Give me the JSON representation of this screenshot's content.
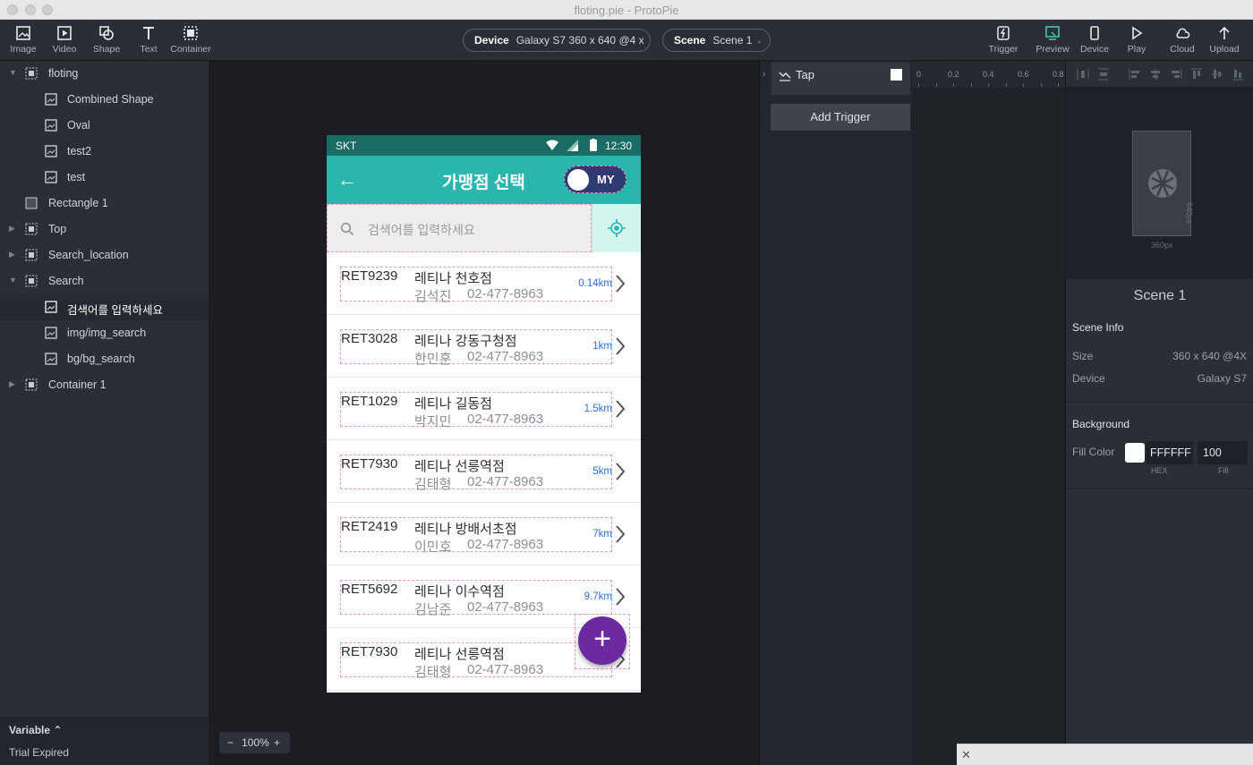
{
  "window": {
    "title": "floting.pie - ProtoPie"
  },
  "toolbar": {
    "left_tools": [
      {
        "label": "Image",
        "icon": "image-icon"
      },
      {
        "label": "Video",
        "icon": "video-icon"
      },
      {
        "label": "Shape",
        "icon": "shape-icon"
      },
      {
        "label": "Text",
        "icon": "text-icon"
      },
      {
        "label": "Container",
        "icon": "container-icon"
      }
    ],
    "device_label": "Device",
    "device_value": "Galaxy S7  360 x 640  @4 x",
    "scene_label": "Scene",
    "scene_value": "Scene 1",
    "right_tools": [
      {
        "label": "Trigger",
        "icon": "trigger-icon"
      },
      {
        "label": "Preview",
        "icon": "preview-icon"
      },
      {
        "label": "Device",
        "icon": "device-icon"
      },
      {
        "label": "Play",
        "icon": "play-icon"
      },
      {
        "label": "Cloud",
        "icon": "cloud-icon"
      },
      {
        "label": "Upload",
        "icon": "upload-icon"
      }
    ]
  },
  "layers": [
    {
      "name": "floting",
      "type": "container",
      "expanded": true,
      "indent": 0
    },
    {
      "name": "Combined Shape",
      "type": "image",
      "indent": 1
    },
    {
      "name": "Oval",
      "type": "image",
      "indent": 1
    },
    {
      "name": "test2",
      "type": "image",
      "indent": 1
    },
    {
      "name": "test",
      "type": "image",
      "indent": 1
    },
    {
      "name": "Rectangle 1",
      "type": "rect",
      "indent": 0
    },
    {
      "name": "Top",
      "type": "container",
      "expanded": false,
      "indent": 0
    },
    {
      "name": "Search_location",
      "type": "container",
      "expanded": false,
      "indent": 0
    },
    {
      "name": "Search",
      "type": "container",
      "expanded": true,
      "indent": 0
    },
    {
      "name": "검색어를 입력하세요",
      "type": "image",
      "indent": 1,
      "selected": true
    },
    {
      "name": "img/img_search",
      "type": "image",
      "indent": 1
    },
    {
      "name": "bg/bg_search",
      "type": "image",
      "indent": 1
    },
    {
      "name": "Container 1",
      "type": "container",
      "expanded": false,
      "indent": 0
    }
  ],
  "variable_panel": {
    "title": "Variable ⌃",
    "status": "Trial Expired"
  },
  "zoom": {
    "minus": "−",
    "value": "100%",
    "plus": "+"
  },
  "phone": {
    "status": {
      "carrier": "SKT",
      "time": "12:30"
    },
    "appbar": {
      "back": "←",
      "title": "가맹점 선택",
      "toggle_label": "MY"
    },
    "search": {
      "placeholder": "검색어를 입력하세요"
    },
    "stores": [
      {
        "code": "RET9239",
        "name": "레티나 천호점",
        "person": "김석진",
        "phone": "02-477-8963",
        "distance": "0.14km"
      },
      {
        "code": "RET3028",
        "name": "레티나 강동구청점",
        "person": "한민훈",
        "phone": "02-477-8963",
        "distance": "1km"
      },
      {
        "code": "RET1029",
        "name": "레티나 길동점",
        "person": "박지민",
        "phone": "02-477-8963",
        "distance": "1.5km"
      },
      {
        "code": "RET7930",
        "name": "레티나 선릉역점",
        "person": "김태형",
        "phone": "02-477-8963",
        "distance": "5km"
      },
      {
        "code": "RET2419",
        "name": "레티나 방배서초점",
        "person": "이민호",
        "phone": "02-477-8963",
        "distance": "7km"
      },
      {
        "code": "RET5692",
        "name": "레티나 이수역점",
        "person": "김남준",
        "phone": "02-477-8963",
        "distance": "9.7km"
      },
      {
        "code": "RET7930",
        "name": "레티나 선릉역점",
        "person": "김태형",
        "phone": "02-477-8963",
        "distance": ""
      }
    ],
    "fab_label": "+"
  },
  "trigger_panel": {
    "trigger_name": "Tap",
    "add_trigger": "Add Trigger",
    "ruler": [
      "0",
      "0.2",
      "0.4",
      "0.6",
      "0.8"
    ]
  },
  "inspector": {
    "preview_width": "360px",
    "preview_height": "640px",
    "scene_title": "Scene 1",
    "scene_info_title": "Scene Info",
    "size_label": "Size",
    "size_value": "360 x 640 @4X",
    "device_label": "Device",
    "device_value": "Galaxy S7",
    "background_title": "Background",
    "fill_color_label": "Fill Color",
    "fill_hex": "FFFFFF",
    "fill_opacity": "100",
    "hex_caption": "HEX",
    "fill_caption": "Fill"
  },
  "colors": {
    "appbar": "#2bb6ad",
    "statusbar": "#1a6b64",
    "fab": "#6c2aa1",
    "toggle": "#2e3a72",
    "distance": "#2a6ed8"
  }
}
